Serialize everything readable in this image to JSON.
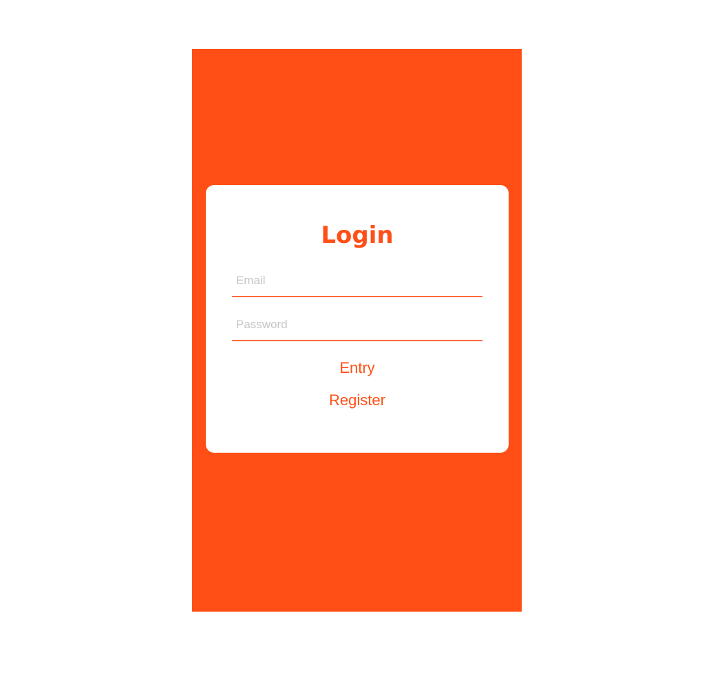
{
  "login": {
    "title": "Login",
    "email": {
      "placeholder": "Email",
      "value": ""
    },
    "password": {
      "placeholder": "Password",
      "value": ""
    },
    "entry_label": "Entry",
    "register_label": "Register"
  },
  "colors": {
    "accent": "#ff4f17",
    "card_background": "#ffffff",
    "page_background": "#ffffff",
    "field_underline": "#ff6a3a",
    "placeholder_text": "#c6c6c6"
  }
}
